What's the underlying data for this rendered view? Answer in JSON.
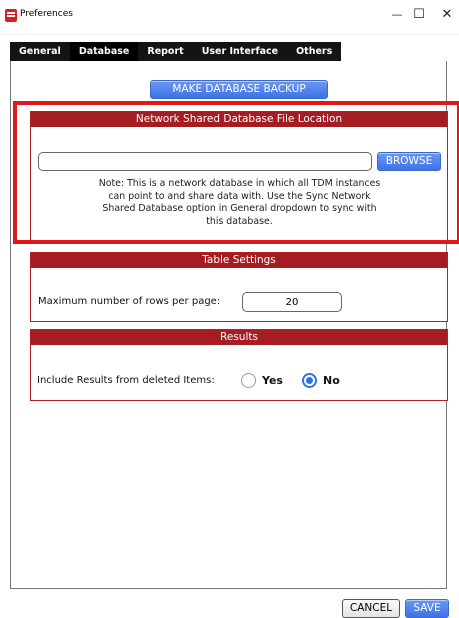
{
  "window": {
    "title": "Preferences",
    "minimize_glyph": "—",
    "maximize_glyph": "☐",
    "close_glyph": "✕"
  },
  "tabs": [
    {
      "label": "General",
      "active": false
    },
    {
      "label": "Database",
      "active": true
    },
    {
      "label": "Report",
      "active": false
    },
    {
      "label": "User Interface",
      "active": false
    },
    {
      "label": "Others",
      "active": false
    }
  ],
  "backup_button": "MAKE DATABASE BACKUP",
  "network_section": {
    "title": "Network Shared Database File Location",
    "path_value": "",
    "browse_label": "BROWSE",
    "note_lines": [
      "Note: This is a network database in which all TDM instances",
      "can point to and share data with. Use the Sync Network",
      "Shared Database option in General dropdown to sync with",
      "this database."
    ]
  },
  "table_section": {
    "title": "Table Settings",
    "rows_label": "Maximum number of rows per page:",
    "rows_value": "20"
  },
  "results_section": {
    "title": "Results",
    "include_label": "Include Results from deleted Items:",
    "options": [
      "Yes",
      "No"
    ],
    "selected": "No"
  },
  "footer": {
    "cancel_label": "CANCEL",
    "save_label": "SAVE"
  },
  "colors": {
    "section_header": "#a51d23",
    "accent_blue": "#3c73e6",
    "highlight_red": "#e01818"
  }
}
